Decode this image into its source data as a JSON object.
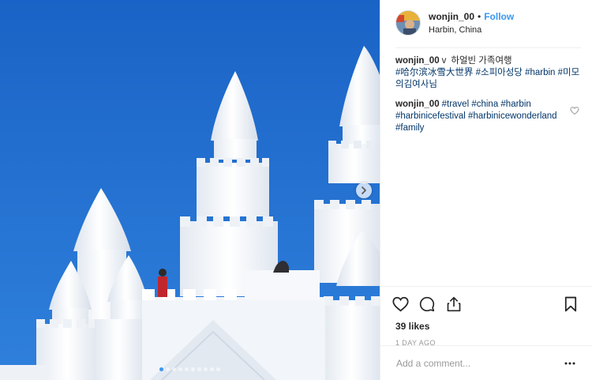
{
  "post": {
    "image_alt": "",
    "carousel": {
      "dot_count": 10,
      "active_index": 0
    }
  },
  "header": {
    "username": "wonjin_00",
    "separator": "•",
    "follow_label": "Follow",
    "location": "Harbin, China"
  },
  "comments": [
    {
      "username": "wonjin_00",
      "prefix": "v",
      "text_plain": "하얼빈 가족여행",
      "tags_line": "#哈尔滨冰雪大世界 #소피아성당 #harbin #미모의김여사님"
    },
    {
      "username": "wonjin_00",
      "tags_line": "#travel #china #harbin #harbinicefestival #harbinicewonderland #family"
    }
  ],
  "actions": {
    "like_icon": "heart-icon",
    "comment_icon": "comment-icon",
    "share_icon": "share-icon",
    "save_icon": "bookmark-icon"
  },
  "likes_text": "39 likes",
  "time_ago": "1 DAY AGO",
  "add_comment": {
    "placeholder": "Add a comment...",
    "more_icon": "ellipsis-icon"
  },
  "colors": {
    "accent": "#3897f0",
    "hashtag": "#003569",
    "sky": "#1f6fcf",
    "snow": "#f4f7fb"
  }
}
